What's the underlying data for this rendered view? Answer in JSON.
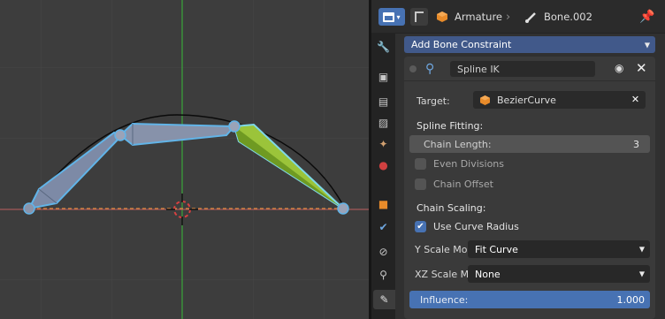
{
  "viewport": {
    "bones": [
      "bone-1",
      "bone-2",
      "bone-3"
    ]
  },
  "header": {
    "object_name": "Armature",
    "separator": "›",
    "bone_name": "Bone.002"
  },
  "tabs": [
    {
      "name": "tool-tab",
      "icon": "tool-icon"
    },
    {
      "name": "render-tab",
      "icon": "render-icon"
    },
    {
      "name": "output-tab",
      "icon": "output-icon"
    },
    {
      "name": "view-layer-tab",
      "icon": "view-layer-icon"
    },
    {
      "name": "scene-tab",
      "icon": "scene-icon"
    },
    {
      "name": "world-tab",
      "icon": "world-icon"
    },
    {
      "name": "object-tab",
      "icon": "object-icon"
    },
    {
      "name": "modifier-tab",
      "icon": "wrench-icon"
    },
    {
      "name": "constraints-tab",
      "icon": "constraint-icon"
    },
    {
      "name": "object-data-tab",
      "icon": "armature-icon"
    },
    {
      "name": "bone-tab",
      "icon": "bone-icon"
    }
  ],
  "panel": {
    "add_constraint": "Add Bone Constraint",
    "constraint_name": "Spline IK",
    "target_label": "Target:",
    "target_value": "BezierCurve",
    "spline_fitting_title": "Spline Fitting:",
    "chain_length_label": "Chain Length:",
    "chain_length_value": "3",
    "even_divisions_label": "Even Divisions",
    "even_divisions_checked": false,
    "chain_offset_label": "Chain Offset",
    "chain_offset_checked": false,
    "chain_scaling_title": "Chain Scaling:",
    "use_curve_radius_label": "Use Curve Radius",
    "use_curve_radius_checked": true,
    "y_scale_label": "Y Scale Mo..",
    "y_scale_value": "Fit Curve",
    "xz_scale_label": "XZ Scale M..",
    "xz_scale_value": "None",
    "influence_label": "Influence:",
    "influence_value": "1.000"
  },
  "colors": {
    "accent": "#4772b3",
    "active_bone": "#9bc43a",
    "selected_outline": "#61b4e8",
    "axis_y": "#3aa63a",
    "axis_x": "#c85050"
  }
}
